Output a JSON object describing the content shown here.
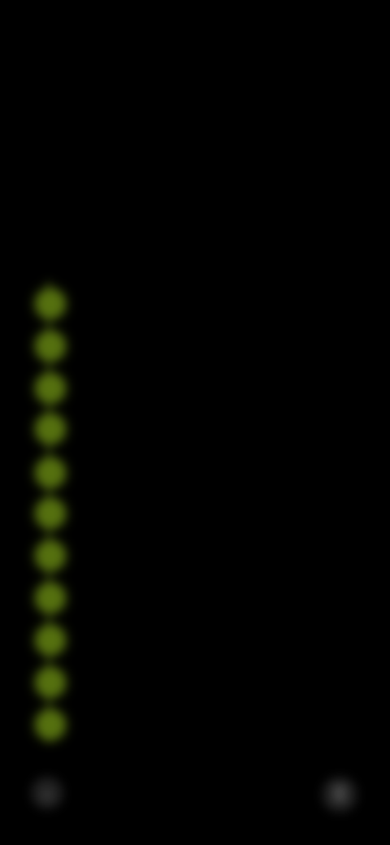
{
  "status_bar": {
    "time": "",
    "icons": ""
  },
  "header": {
    "title": "",
    "subtitle": ""
  },
  "steps": [
    {
      "label": ""
    },
    {
      "label": ""
    },
    {
      "label": ""
    },
    {
      "label": ""
    },
    {
      "label": ""
    },
    {
      "label": ""
    },
    {
      "label": ""
    },
    {
      "label": ""
    },
    {
      "label": ""
    },
    {
      "label": ""
    },
    {
      "label": ""
    }
  ],
  "colors": {
    "background": "#000000",
    "accent": "#55700f",
    "line": "#3c4a12",
    "title": "#f2f2f2",
    "muted": "#7d7d7d"
  },
  "icons": {
    "bottom_left": "home-icon",
    "bottom_right": "menu-icon"
  }
}
